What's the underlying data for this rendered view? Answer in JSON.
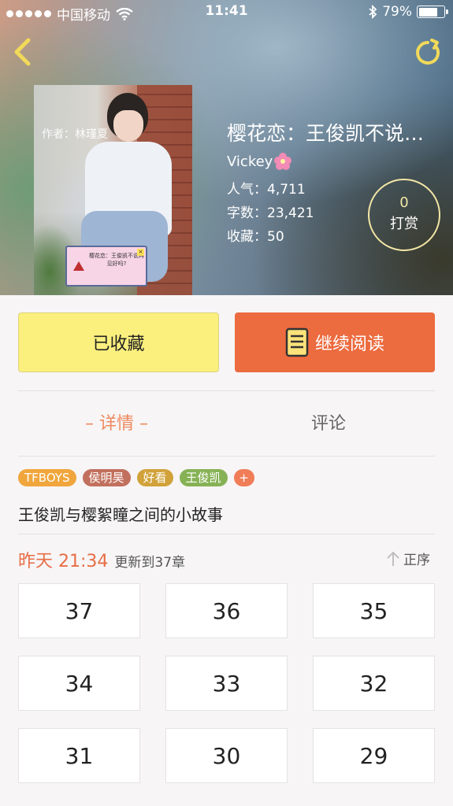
{
  "status_bar": {
    "carrier": "中国移动",
    "time": "11:41",
    "battery": "79%",
    "battery_level": 0.79
  },
  "book": {
    "title": "樱花恋：王俊凯不说…",
    "author": "Vickey",
    "popularity_label": "人气：",
    "popularity": "4,711",
    "words_label": "字数：",
    "words": "23,421",
    "favorites_label": "收藏：",
    "favorites": "50",
    "cover": {
      "author_text": "作者：林瑾夏",
      "popup_text": "樱花恋：王俊凯不说再见好吗?"
    }
  },
  "reward": {
    "count": "0",
    "label": "打赏"
  },
  "buttons": {
    "favorited": "已收藏",
    "continue_reading": "继续阅读"
  },
  "tabs": {
    "detail": "– 详情 –",
    "comments": "评论"
  },
  "tags": [
    {
      "label": "TFBOYS",
      "color": "#f0a63c"
    },
    {
      "label": "侯明昊",
      "color": "#c2705e"
    },
    {
      "label": "好看",
      "color": "#d1a23a"
    },
    {
      "label": "王俊凯",
      "color": "#86b255"
    }
  ],
  "tag_add": "+",
  "description": "王俊凯与樱絮瞳之间的小故事",
  "update": {
    "time": "昨天 21:34",
    "info": "更新到37章",
    "order": "正序"
  },
  "chapters": [
    "37",
    "36",
    "35",
    "34",
    "33",
    "32",
    "31",
    "30",
    "29"
  ],
  "colors": {
    "accent": "#ec6b3f",
    "favorite_button": "#fbf07e",
    "tab_active": "#ee8a5e"
  }
}
